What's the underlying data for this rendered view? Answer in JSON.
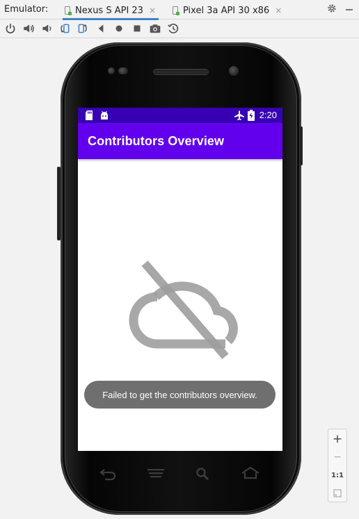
{
  "header": {
    "label": "Emulator:",
    "tabs": [
      {
        "label": "Nexus S API 23",
        "active": true
      },
      {
        "label": "Pixel 3a API 30 x86",
        "active": false
      }
    ],
    "close_glyph": "×"
  },
  "toolbar": {
    "tools": [
      "power-icon",
      "volume-up-icon",
      "volume-down-icon",
      "rotate-left-icon",
      "rotate-right-icon",
      "back-icon",
      "home-icon",
      "overview-icon",
      "screenshot-icon",
      "snapshot-icon"
    ]
  },
  "device": {
    "status_time": "2:20",
    "app_title": "Contributors Overview",
    "toast_message": "Failed to get the contributors overview.",
    "accent_primary": "#6200ee",
    "accent_dark": "#3700b3"
  },
  "zoom": {
    "zoom_in": "+",
    "zoom_out": "−",
    "actual_size": "1:1"
  }
}
